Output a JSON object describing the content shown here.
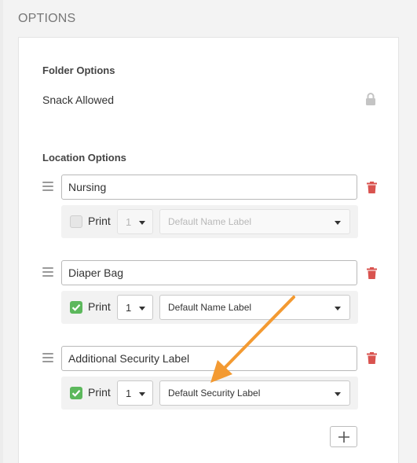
{
  "section": {
    "title": "OPTIONS"
  },
  "folder": {
    "heading": "Folder Options",
    "snack_label": "Snack Allowed",
    "lock_icon": "lock-icon"
  },
  "location": {
    "heading": "Location Options",
    "items": [
      {
        "name": "Nursing",
        "print_label": "Print",
        "print_checked": false,
        "quantity": "1",
        "label_template": "Default Name Label",
        "enabled": false
      },
      {
        "name": "Diaper Bag",
        "print_label": "Print",
        "print_checked": true,
        "quantity": "1",
        "label_template": "Default Name Label",
        "enabled": true
      },
      {
        "name": "Additional Security Label",
        "print_label": "Print",
        "print_checked": true,
        "quantity": "1",
        "label_template": "Default Security Label",
        "enabled": true
      }
    ],
    "add_icon": "plus-icon"
  },
  "colors": {
    "accent_green": "#5cb85c",
    "delete_red": "#d9534f",
    "annotation_orange": "#f39a32"
  }
}
